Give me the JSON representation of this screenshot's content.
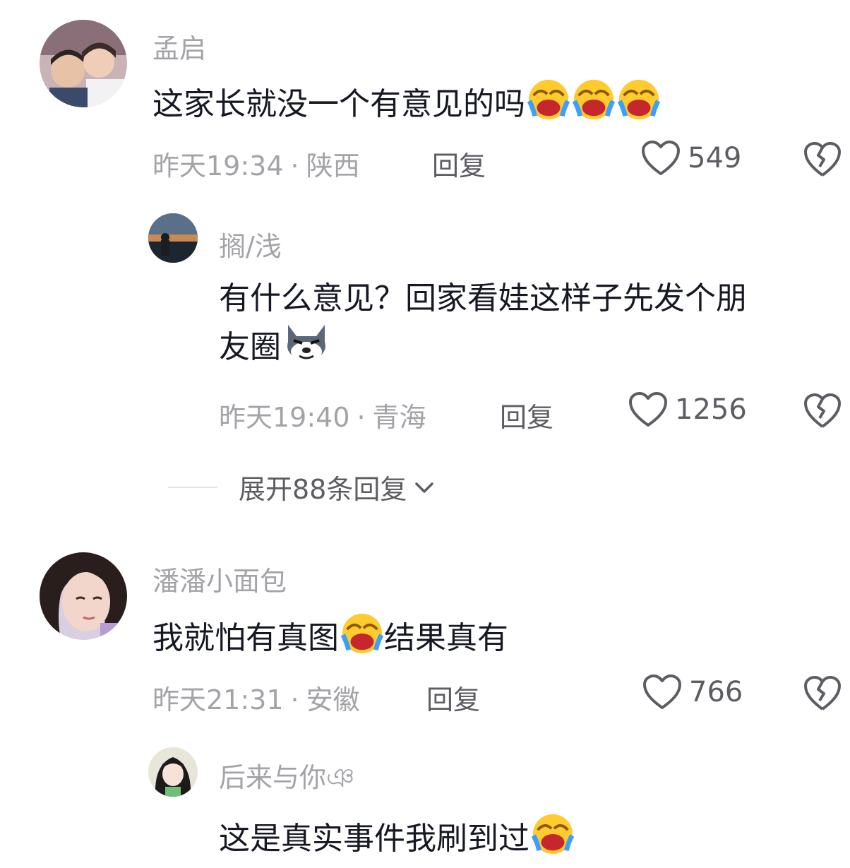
{
  "comments": [
    {
      "username": "孟启",
      "text": "这家长就没一个有意见的吗",
      "emojis": [
        "laugh-cry-emoji",
        "laugh-cry-emoji",
        "laugh-cry-emoji"
      ],
      "time": "昨天19:34",
      "location": "陕西",
      "reply_label": "回复",
      "likes": "549"
    },
    {
      "username": "搁/浅",
      "text_line1": "有什么意见？回家看娃这样子先发个朋",
      "text_line2": "友圈",
      "emojis": [
        "husky-emoji"
      ],
      "time": "昨天19:40",
      "location": "青海",
      "reply_label": "回复",
      "likes": "1256"
    },
    {
      "username": "潘潘小面包",
      "text_before": "我就怕有真图",
      "text_after": "结果真有",
      "emojis": [
        "laugh-cry-emoji"
      ],
      "time": "昨天21:31",
      "location": "安徽",
      "reply_label": "回复",
      "likes": "766"
    },
    {
      "username": "后来与你ঞ",
      "text": "这是真实事件我刷到过",
      "emojis": [
        "laugh-cry-emoji"
      ]
    }
  ],
  "expand_replies": "展开88条回复",
  "separator": "·",
  "colors": {
    "text": "#161823",
    "muted": "#a3a3a8",
    "action": "#5c5c63"
  }
}
